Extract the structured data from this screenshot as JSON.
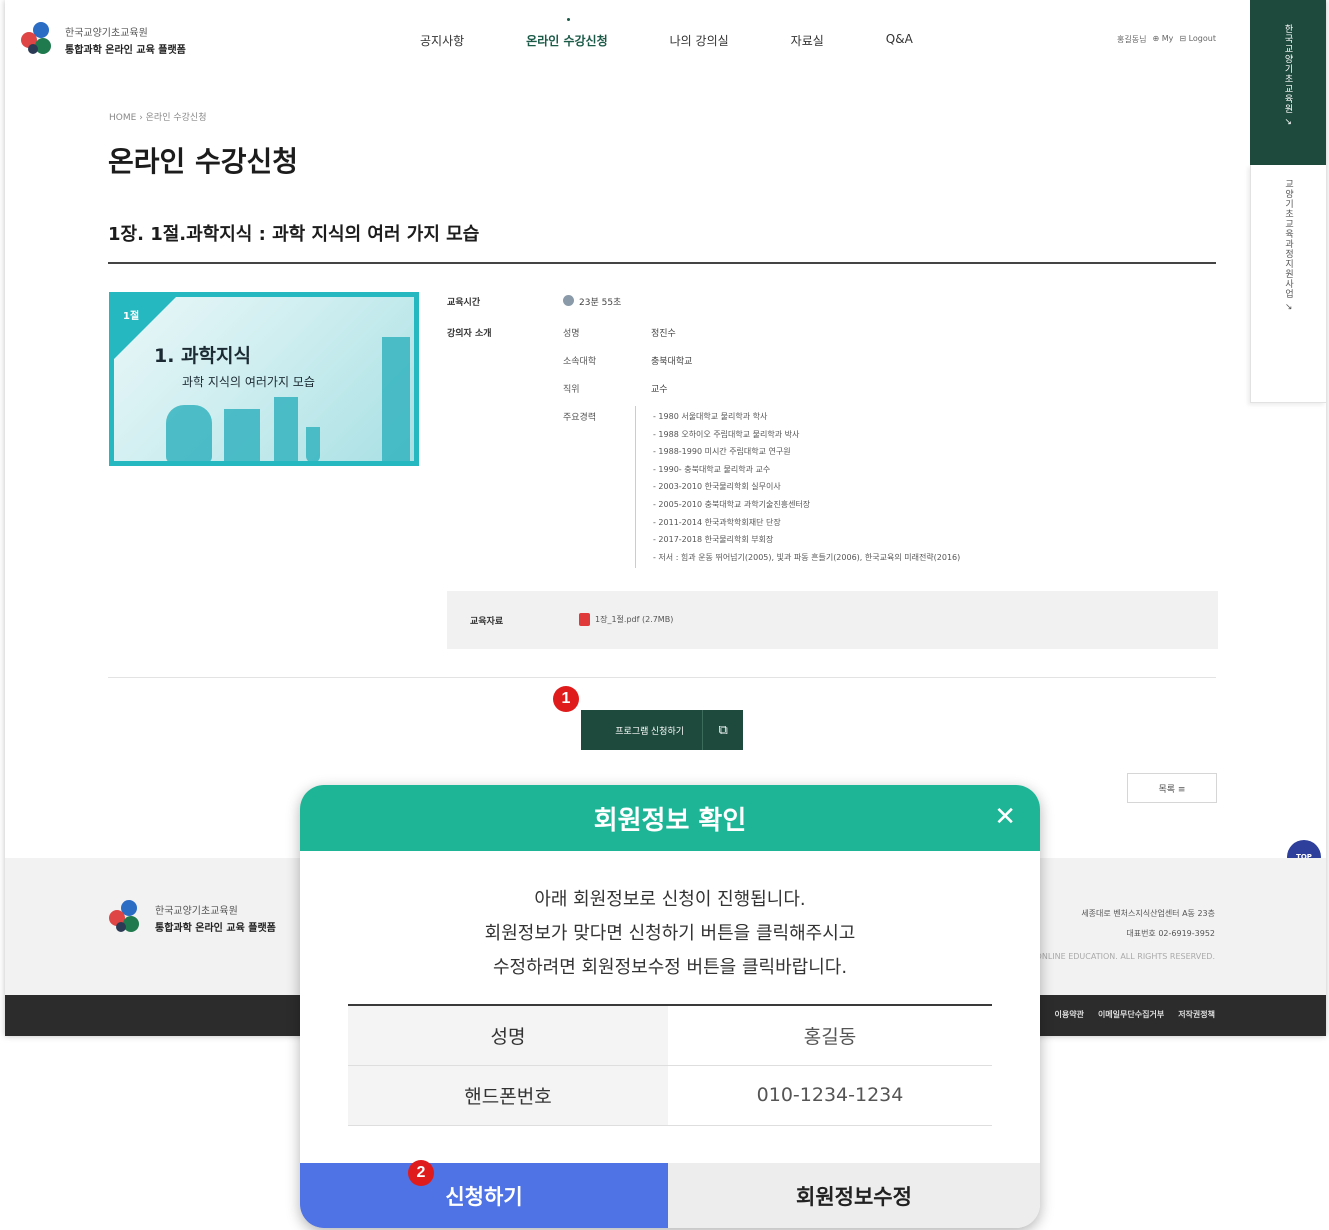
{
  "header": {
    "logo_line1": "한국교양기초교육원",
    "logo_line2": "통합과학 온라인 교육 플랫폼",
    "nav": [
      "공지사항",
      "온라인 수강신청",
      "나의 강의실",
      "자료실",
      "Q&A"
    ],
    "util": [
      "홍길동님",
      "⊕ My",
      "⊟ Logout"
    ]
  },
  "side_tabs": {
    "dark": "한국교양기초교육원 ↗",
    "light": "교양기초교육과정지원사업 ↗"
  },
  "breadcrumb": {
    "home": "HOME",
    "current": "온라인 수강신청"
  },
  "page_title": "온라인 수강신청",
  "lecture": {
    "title": "1장. 1절.과학지식 : 과학 지식의 여러 가지 모습",
    "thumb_badge": "1절",
    "thumb_line1": "1. 과학지식",
    "thumb_line2": "과학 지식의 여러가지 모습",
    "duration_label": "교육시간",
    "duration": "23분 55초",
    "instructor_label": "강의자 소개",
    "name_key": "성명",
    "name": "정진수",
    "affiliation_key": "소속대학",
    "affiliation": "충북대학교",
    "position_key": "직위",
    "position": "교수",
    "career_key": "주요경력",
    "career": [
      "- 1980 서울대학교 물리학과 학사",
      "- 1988 오하이오 주립대학교 물리학과 박사",
      "- 1988-1990 미시간 주립대학교 연구원",
      "- 1990- 충북대학교 물리학과 교수",
      "- 2003-2010 한국물리학회 실무이사",
      "- 2005-2010 충북대학교 과학기술진흥센터장",
      "- 2011-2014 한국과학학회재단 단장",
      "- 2017-2018 한국물리학회 부회장",
      "- 저서 : 힘과 운동 뛰어넘기(2005), 빛과 파동 흔들기(2006), 한국교육의 미래전략(2016)"
    ],
    "materials_label": "교육자료",
    "material_file": "1장_1절.pdf (2.7MB)"
  },
  "apply_button": "프로그램 신청하기",
  "list_button": "목록 ≡",
  "top_button": "TOP",
  "footer": {
    "logo_line1": "한국교양기초교육원",
    "logo_line2": "통합과학 온라인 교육 플랫폼",
    "address": "세종대로 벤처스지식산업센터 A동 23층",
    "phone": "대표번호 02-6919-3952",
    "copyright": "COPYRIGHT (C) INTEGRATED SCIENCE ONLINE EDUCATION. ALL RIGHTS RESERVED.",
    "links": [
      "이용약관",
      "이메일무단수집거부",
      "저작권정책"
    ]
  },
  "steps": {
    "one": "1",
    "two": "2"
  },
  "modal": {
    "title": "회원정보 확인",
    "close": "✕",
    "message": [
      "아래 회원정보로 신청이 진행됩니다.",
      "회원정보가 맞다면 신청하기 버튼을 클릭해주시고",
      "수정하려면 회원정보수정 버튼을 클릭바랍니다."
    ],
    "rows": [
      {
        "key": "성명",
        "value": "홍길동"
      },
      {
        "key": "핸드폰번호",
        "value": "010-1234-1234"
      }
    ],
    "submit": "신청하기",
    "edit": "회원정보수정"
  },
  "colors": {
    "brand_dark_green": "#1e4a3d",
    "modal_header": "#1eb596",
    "submit_blue": "#4f72e4",
    "step_red": "#e01b1b",
    "top_button": "#2d3e9b"
  }
}
